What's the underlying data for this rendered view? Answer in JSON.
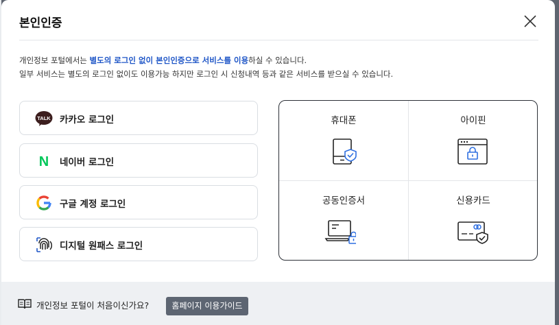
{
  "modal": {
    "title": "본인인증",
    "description": {
      "line1_pre": "개인정보 포털에서는 ",
      "line1_highlight": "별도의 로그인 없이 본인인증으로 서비스를 이용",
      "line1_post": "하실 수 있습니다.",
      "line2": "일부 서비스는 별도의 로그인 없이도 이용가능 하지만 로그인 시 신청내역 등과 같은 서비스를 받으실 수 있습니다."
    },
    "login_options": [
      {
        "label": "카카오 로그인",
        "icon": "kakao-talk-icon",
        "icon_text": "TALK"
      },
      {
        "label": "네이버 로그인",
        "icon": "naver-icon",
        "icon_text": "N"
      },
      {
        "label": "구글 계정 로그인",
        "icon": "google-icon"
      },
      {
        "label": "디지털 원패스 로그인",
        "icon": "fingerprint-icon"
      }
    ],
    "auth_methods": [
      {
        "label": "휴대폰",
        "icon": "mobile-phone-shield-icon"
      },
      {
        "label": "아이핀",
        "icon": "ipin-browser-lock-icon"
      },
      {
        "label": "공동인증서",
        "icon": "certificate-laptop-lock-icon"
      },
      {
        "label": "신용카드",
        "icon": "credit-card-shield-icon"
      }
    ],
    "footer": {
      "question": "개인정보 포털이 처음이신가요?",
      "guide_button": "홈페이지 이용가이드",
      "icon": "book-icon"
    }
  },
  "colors": {
    "accent": "#1f56c7",
    "kakao": "#3c1e1e",
    "naver": "#03c75a",
    "overlay": "#5f6570",
    "footer_bg": "#eef0f3",
    "guide_button_bg": "#5d6572",
    "icon_blue": "#2d6ee0"
  }
}
